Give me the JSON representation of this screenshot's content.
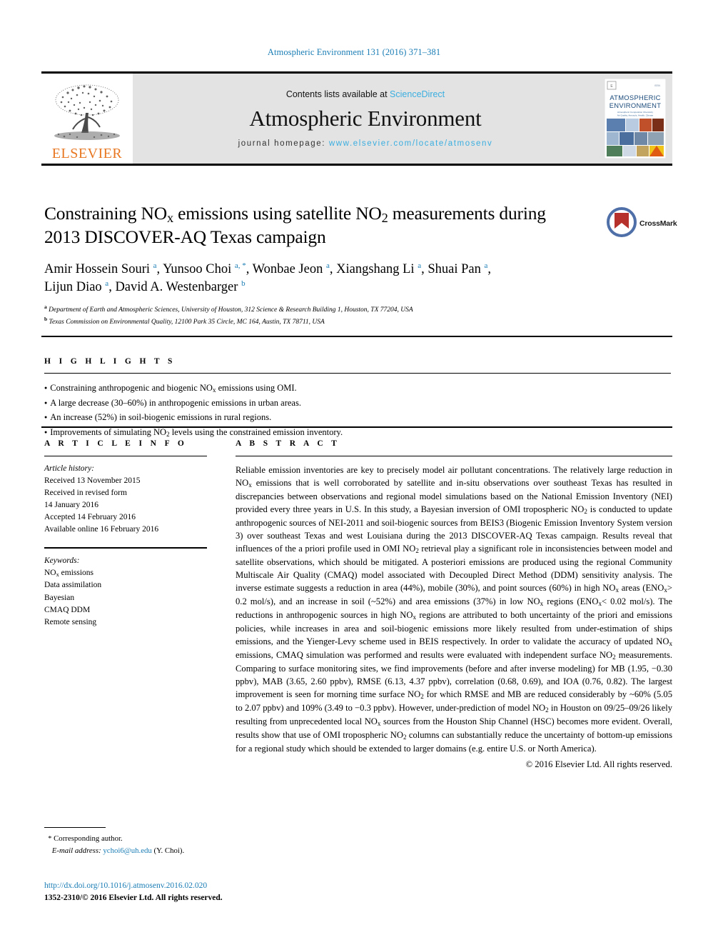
{
  "running_head": "Atmospheric Environment 131 (2016) 371–381",
  "masthead": {
    "publisher_logo_text": "ELSEVIER",
    "contents_prefix": "Contents lists available at ",
    "contents_link": "ScienceDirect",
    "journal_name": "Atmospheric Environment",
    "homepage_prefix": "journal homepage: ",
    "homepage_url": "www.elsevier.com/locate/atmosenv",
    "cover": {
      "line1": "ATMOSPHERIC",
      "line2": "ENVIRONMENT",
      "subtitle": "Atmospheric Composition Chemistry Gas-Air Quality Aerosols, Health, Climate"
    },
    "accent_color": "#3aaee0",
    "elsevier_orange": "#E87722",
    "band_color": "#e3e3e3"
  },
  "article": {
    "title_line1": "Constraining NO",
    "title_sub1": "x",
    "title_line1b": " emissions using satellite NO",
    "title_sub2": "2",
    "title_line1c": " measurements during",
    "title_line2": "2013 DISCOVER-AQ Texas campaign",
    "crossmark_label": "CrossMark",
    "authors": [
      {
        "name": "Amir Hossein Souri",
        "marks": "a",
        "sep": ", "
      },
      {
        "name": "Yunsoo Choi",
        "marks": "a, *",
        "sep": ", "
      },
      {
        "name": "Wonbae Jeon",
        "marks": "a",
        "sep": ", "
      },
      {
        "name": "Xiangshang Li",
        "marks": "a",
        "sep": ", "
      },
      {
        "name": "Shuai Pan",
        "marks": "a",
        "sep": ", "
      },
      {
        "name": "Lijun Diao",
        "marks": "a",
        "sep": ", "
      },
      {
        "name": "David A. Westenbarger",
        "marks": "b",
        "sep": ""
      }
    ],
    "affiliations": [
      {
        "mark": "a",
        "text": "Department of Earth and Atmospheric Sciences, University of Houston, 312 Science & Research Building 1, Houston, TX 77204, USA"
      },
      {
        "mark": "b",
        "text": "Texas Commission on Environmental Quality, 12100 Park 35 Circle, MC 164, Austin, TX 78711, USA"
      }
    ]
  },
  "highlights": {
    "label": "H I G H L I G H T S",
    "items": [
      "Constraining anthropogenic and biogenic NOx emissions using OMI.",
      "A large decrease (30–60%) in anthropogenic emissions in urban areas.",
      "An increase (52%) in soil-biogenic emissions in rural regions.",
      "Improvements of simulating NO2 levels using the constrained emission inventory."
    ]
  },
  "article_info": {
    "label": "A R T I C L E   I N F O",
    "history_header": "Article history:",
    "history_lines": [
      "Received 13 November 2015",
      "Received in revised form",
      "14 January 2016",
      "Accepted 14 February 2016",
      "Available online 16 February 2016"
    ],
    "keywords_header": "Keywords:",
    "keywords": [
      "NOx emissions",
      "Data assimilation",
      "Bayesian",
      "CMAQ DDM",
      "Remote sensing"
    ]
  },
  "abstract": {
    "label": "A B S T R A C T",
    "text": "Reliable emission inventories are key to precisely model air pollutant concentrations. The relatively large reduction in NOx emissions that is well corroborated by satellite and in-situ observations over southeast Texas has resulted in discrepancies between observations and regional model simulations based on the National Emission Inventory (NEI) provided every three years in U.S. In this study, a Bayesian inversion of OMI tropospheric NO2 is conducted to update anthropogenic sources of NEI-2011 and soil-biogenic sources from BEIS3 (Biogenic Emission Inventory System version 3) over southeast Texas and west Louisiana during the 2013 DISCOVER-AQ Texas campaign. Results reveal that influences of the a priori profile used in OMI NO2 retrieval play a significant role in inconsistencies between model and satellite observations, which should be mitigated. A posteriori emissions are produced using the regional Community Multiscale Air Quality (CMAQ) model associated with Decoupled Direct Method (DDM) sensitivity analysis. The inverse estimate suggests a reduction in area (44%), mobile (30%), and point sources (60%) in high NOx areas (ENOx> 0.2 mol/s), and an increase in soil (~52%) and area emissions (37%) in low NOx regions (ENOx< 0.02 mol/s). The reductions in anthropogenic sources in high NOx regions are attributed to both uncertainty of the priori and emissions policies, while increases in area and soil-biogenic emissions more likely resulted from under-estimation of ships emissions, and the Yienger-Levy scheme used in BEIS respectively. In order to validate the accuracy of updated NOx emissions, CMAQ simulation was performed and results were evaluated with independent surface NO2 measurements. Comparing to surface monitoring sites, we find improvements (before and after inverse modeling) for MB (1.95, −0.30 ppbv), MAB (3.65, 2.60 ppbv), RMSE (6.13, 4.37 ppbv), correlation (0.68, 0.69), and IOA (0.76, 0.82). The largest improvement is seen for morning time surface NO2 for which RMSE and MB are reduced considerably by ~60% (5.05 to 2.07 ppbv) and 109% (3.49 to −0.3 ppbv). However, under-prediction of model NO2 in Houston on 09/25–09/26 likely resulting from unprecedented local NOx sources from the Houston Ship Channel (HSC) becomes more evident. Overall, results show that use of OMI tropospheric NO2 columns can substantially reduce the uncertainty of bottom-up emissions for a regional study which should be extended to larger domains (e.g. entire U.S. or North America).",
    "copyright": "© 2016 Elsevier Ltd. All rights reserved."
  },
  "footer": {
    "corresponding_star": "*",
    "corresponding_label": "Corresponding author.",
    "email_label": "E-mail address:",
    "email": "ychoi6@uh.edu",
    "email_owner": "(Y. Choi).",
    "doi": "http://dx.doi.org/10.1016/j.atmosenv.2016.02.020",
    "issn_line": "1352-2310/© 2016 Elsevier Ltd. All rights reserved."
  }
}
